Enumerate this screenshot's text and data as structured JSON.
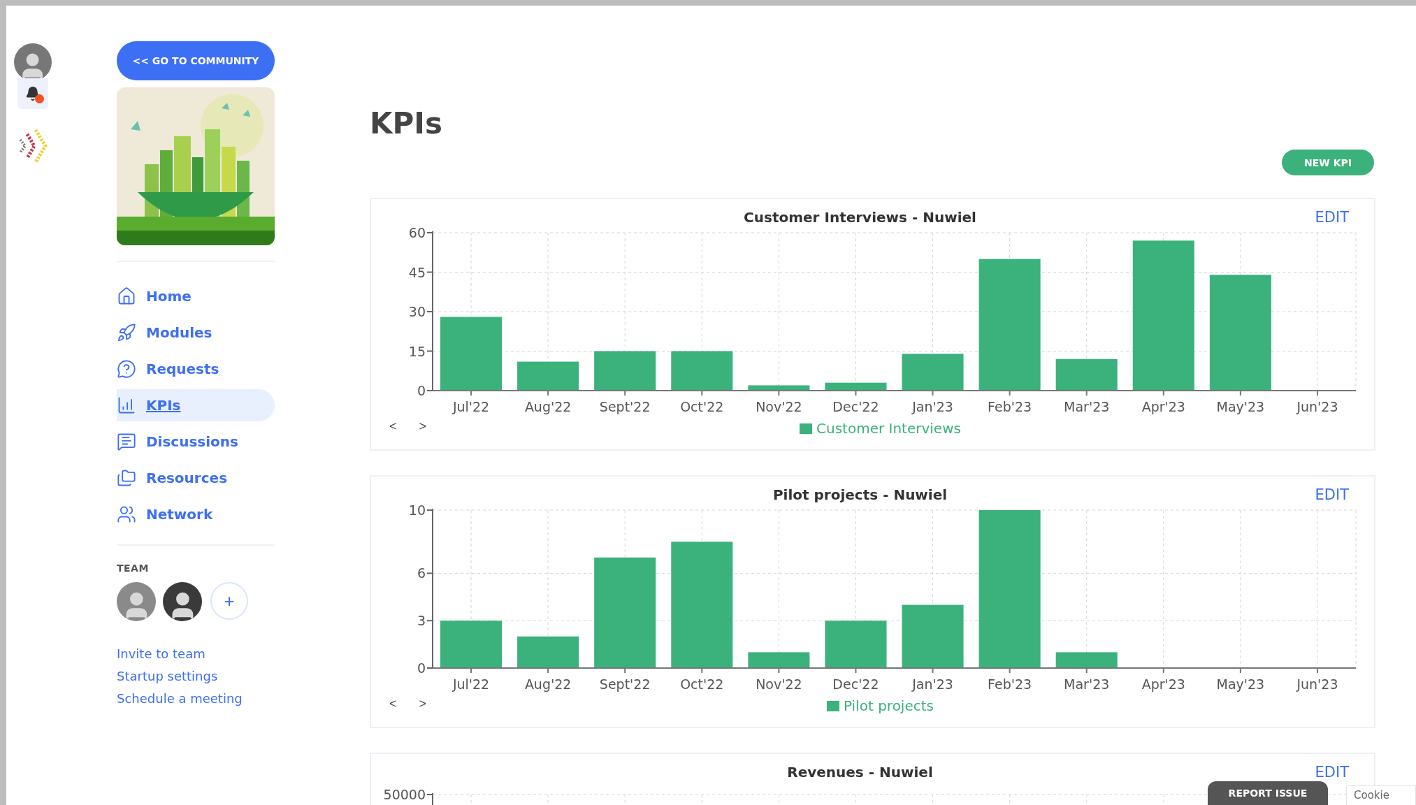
{
  "rail": {
    "notifications": {
      "unread": true
    }
  },
  "sidebar": {
    "community_button": "<< GO TO COMMUNITY",
    "nav": [
      {
        "label": "Home",
        "selected": false
      },
      {
        "label": "Modules",
        "selected": false
      },
      {
        "label": "Requests",
        "selected": false
      },
      {
        "label": "KPIs",
        "selected": true
      },
      {
        "label": "Discussions",
        "selected": false
      },
      {
        "label": "Resources",
        "selected": false
      },
      {
        "label": "Network",
        "selected": false
      }
    ],
    "team": {
      "title": "TEAM",
      "members": [
        {
          "kind": "photo"
        },
        {
          "kind": "photo"
        }
      ],
      "add": "+"
    },
    "links": [
      "Invite to team",
      "Startup settings",
      "Schedule a meeting"
    ]
  },
  "main": {
    "title": "KPIs",
    "new_button": "NEW KPI",
    "kpis": [
      {
        "kind": "chart",
        "title": "Customer Interviews - Nuwiel",
        "edit": "EDIT",
        "prev": "<",
        "next": ">",
        "chart_data": {
          "type": "bar",
          "categories": [
            "Jul'22",
            "Aug'22",
            "Sept'22",
            "Oct'22",
            "Nov'22",
            "Dec'22",
            "Jan'23",
            "Feb'23",
            "Mar'23",
            "Apr'23",
            "May'23",
            "Jun'23"
          ],
          "series": [
            {
              "name": "Customer Interviews",
              "color": "#3bb27b",
              "values": [
                28,
                11,
                15,
                15,
                2,
                3,
                14,
                50,
                12,
                57,
                44,
                0
              ]
            }
          ],
          "ylim": [
            0,
            60
          ],
          "yticks": [
            0,
            15,
            30,
            45,
            60
          ],
          "grid": true
        }
      },
      {
        "kind": "chart",
        "title": "Pilot projects - Nuwiel",
        "edit": "EDIT",
        "prev": "<",
        "next": ">",
        "chart_data": {
          "type": "bar",
          "categories": [
            "Jul'22",
            "Aug'22",
            "Sept'22",
            "Oct'22",
            "Nov'22",
            "Dec'22",
            "Jan'23",
            "Feb'23",
            "Mar'23",
            "Apr'23",
            "May'23",
            "Jun'23"
          ],
          "series": [
            {
              "name": "Pilot projects",
              "color": "#3bb27b",
              "values": [
                3,
                2,
                7,
                8,
                1,
                3,
                4,
                10,
                1,
                0,
                0,
                0
              ]
            }
          ],
          "ylim": [
            0,
            10
          ],
          "yticks": [
            0,
            3,
            6,
            10
          ],
          "grid": true
        }
      },
      {
        "kind": "cut_off",
        "title": "Revenues - Nuwiel",
        "edit": "EDIT",
        "visible_tick": "50000"
      }
    ]
  },
  "report_issue": "REPORT ISSUE",
  "cookie": "Cookie"
}
